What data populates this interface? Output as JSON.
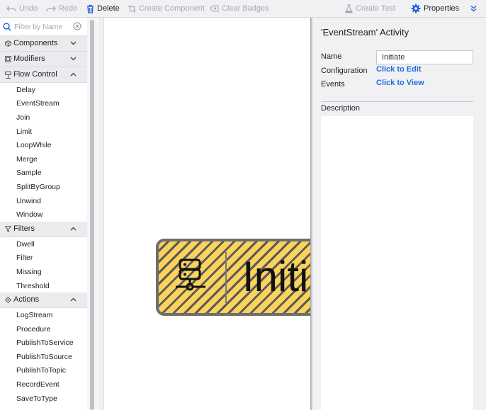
{
  "toolbar": {
    "undo": "Undo",
    "redo": "Redo",
    "delete": "Delete",
    "create_component": "Create Component",
    "clear_badges": "Clear Badges",
    "create_test": "Create Test",
    "properties": "Properties"
  },
  "filter": {
    "placeholder": "Filter by Name"
  },
  "tree": {
    "components": {
      "label": "Components",
      "expanded": false
    },
    "modifiers": {
      "label": "Modifiers",
      "expanded": false
    },
    "flow_control": {
      "label": "Flow Control",
      "expanded": true,
      "items": [
        "Delay",
        "EventStream",
        "Join",
        "Limit",
        "LoopWhile",
        "Merge",
        "Sample",
        "SplitByGroup",
        "Unwind",
        "Window"
      ]
    },
    "filters": {
      "label": "Filters",
      "expanded": true,
      "items": [
        "Dwell",
        "Filter",
        "Missing",
        "Threshold"
      ]
    },
    "actions": {
      "label": "Actions",
      "expanded": true,
      "items": [
        "LogStream",
        "Procedure",
        "PublishToService",
        "PublishToSource",
        "PublishToTopic",
        "RecordEvent",
        "SaveToType"
      ]
    }
  },
  "canvas": {
    "node": {
      "label": "Initiate",
      "icon": "server-icon"
    }
  },
  "properties": {
    "title": "'EventStream' Activity",
    "name_label": "Name",
    "name_value": "Initiate",
    "configuration_label": "Configuration",
    "configuration_link": "Click to Edit",
    "events_label": "Events",
    "events_link": "Click to View",
    "description_label": "Description"
  },
  "colors": {
    "link": "#1d6ce0",
    "accent": "#1d6ce0",
    "stripe_yellow": "#fbd25a",
    "stripe_dark": "#5a5a5a",
    "disabled_text": "#a7a9b4"
  }
}
